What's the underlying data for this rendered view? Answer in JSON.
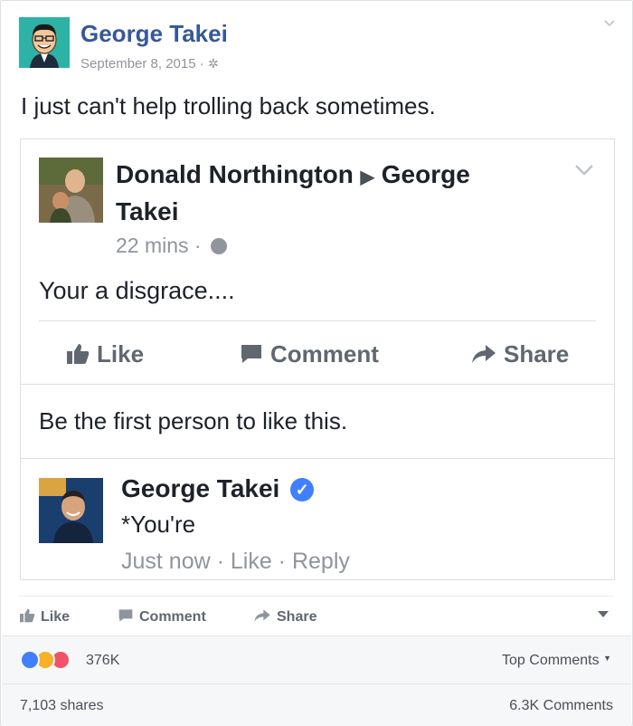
{
  "post": {
    "author": "George Takei",
    "date": "September 8, 2015",
    "separator": "·",
    "privacy_icon": "gear-icon",
    "status_text": "I just can't help trolling back sometimes."
  },
  "screenshot": {
    "poster": "Donald Northington",
    "target_line1": "George",
    "target_line2": "Takei",
    "time": "22 mins ·",
    "message": "Your a disgrace....",
    "actions": {
      "like": "Like",
      "comment": "Comment",
      "share": "Share"
    },
    "first_like": "Be the first person to like this.",
    "comment": {
      "author": "George Takei",
      "text": "*You're",
      "meta": "Just now · Like · Reply"
    }
  },
  "actions": {
    "like": "Like",
    "comment": "Comment",
    "share": "Share"
  },
  "reactions": {
    "count": "376K",
    "sort": "Top Comments",
    "colors": {
      "like": "#4080ff",
      "haha": "#f7b125",
      "love": "#f25268"
    }
  },
  "footer": {
    "shares": "7,103 shares",
    "comments": "6.3K Comments"
  }
}
